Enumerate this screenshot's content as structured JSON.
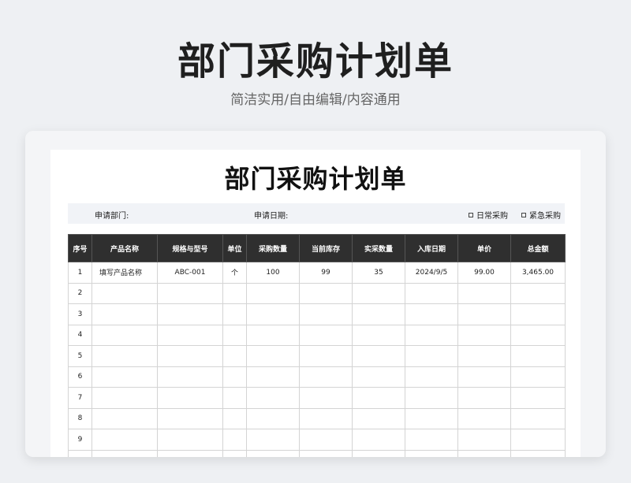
{
  "banner": {
    "title": "部门采购计划单",
    "subtitle": "简洁实用/自由编辑/内容通用"
  },
  "document": {
    "title": "部门采购计划单",
    "department_label": "申请部门:",
    "date_label": "申请日期:",
    "option_regular": "日常采购",
    "option_urgent": "紧急采购"
  },
  "table": {
    "headers": [
      "序号",
      "产品名称",
      "规格与型号",
      "单位",
      "采购数量",
      "当前库存",
      "实采数量",
      "入库日期",
      "单价",
      "总金额"
    ],
    "rows": [
      [
        "1",
        "填写产品名称",
        "ABC-001",
        "个",
        "100",
        "99",
        "35",
        "2024/9/5",
        "99.00",
        "3,465.00"
      ],
      [
        "2",
        "",
        "",
        "",
        "",
        "",
        "",
        "",
        "",
        ""
      ],
      [
        "3",
        "",
        "",
        "",
        "",
        "",
        "",
        "",
        "",
        ""
      ],
      [
        "4",
        "",
        "",
        "",
        "",
        "",
        "",
        "",
        "",
        ""
      ],
      [
        "5",
        "",
        "",
        "",
        "",
        "",
        "",
        "",
        "",
        ""
      ],
      [
        "6",
        "",
        "",
        "",
        "",
        "",
        "",
        "",
        "",
        ""
      ],
      [
        "7",
        "",
        "",
        "",
        "",
        "",
        "",
        "",
        "",
        ""
      ],
      [
        "8",
        "",
        "",
        "",
        "",
        "",
        "",
        "",
        "",
        ""
      ],
      [
        "9",
        "",
        "",
        "",
        "",
        "",
        "",
        "",
        "",
        ""
      ],
      [
        "",
        "",
        "",
        "",
        "",
        "",
        "",
        "",
        "",
        ""
      ]
    ]
  }
}
